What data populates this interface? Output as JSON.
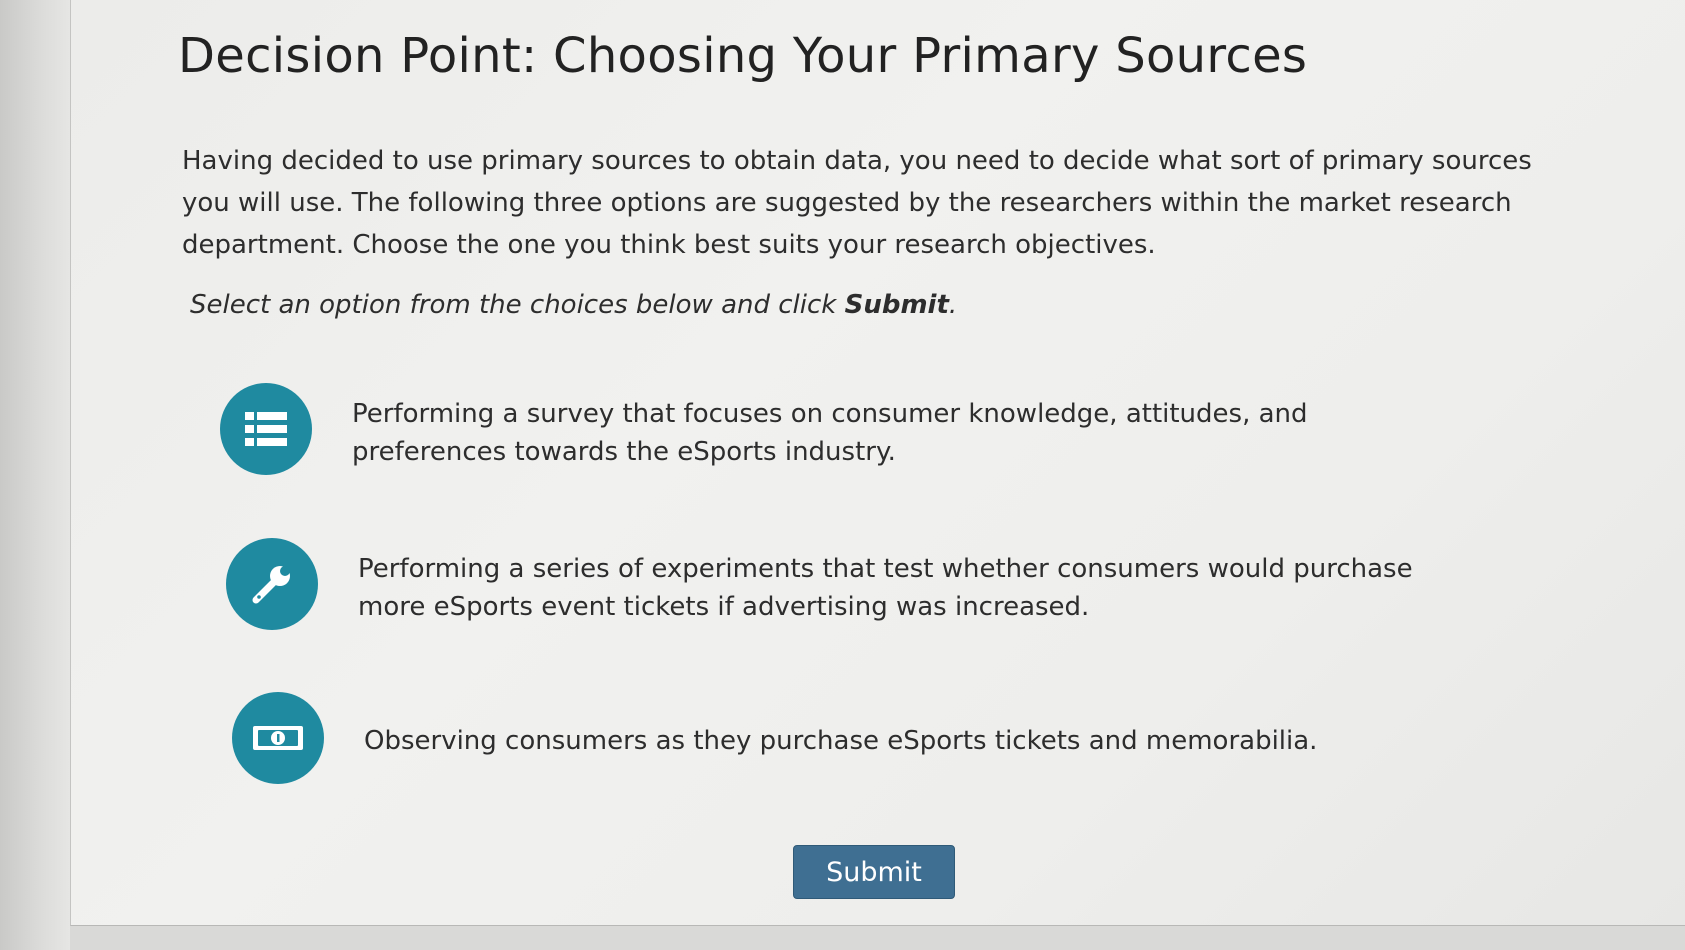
{
  "page": {
    "title": "Decision Point: Choosing Your Primary Sources",
    "intro": "Having decided to use primary sources to obtain data, you need to decide what sort of primary sources you will use. The following three options are suggested by the researchers within the market research department. Choose the one you think best suits your research objectives.",
    "instruction_prefix": "Select an option from the choices below and click ",
    "instruction_bold": "Submit",
    "instruction_suffix": "."
  },
  "options": [
    {
      "icon": "list-icon",
      "text": "Performing a survey that focuses on consumer knowledge, attitudes, and preferences towards the eSports industry."
    },
    {
      "icon": "wrench-icon",
      "text": "Performing a series of experiments that test whether consumers would purchase more eSports event tickets if advertising was increased."
    },
    {
      "icon": "money-icon",
      "text": "Observing consumers as they purchase eSports tickets and memorabilia."
    }
  ],
  "submit_label": "Submit",
  "colors": {
    "icon_circle": "#1f8aa0",
    "submit_button": "#3f6f92"
  }
}
